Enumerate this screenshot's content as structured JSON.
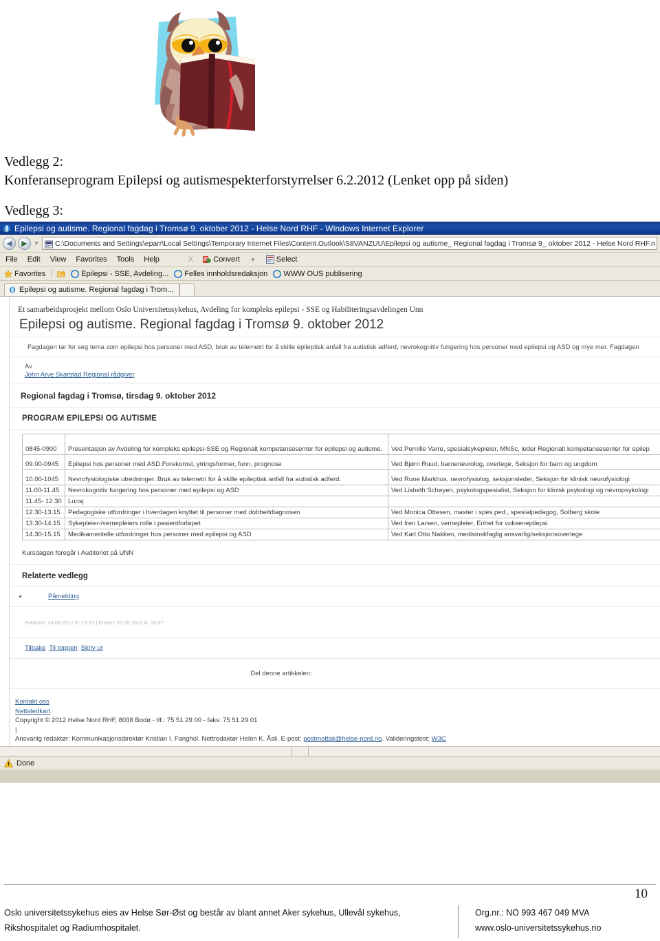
{
  "document": {
    "logo_alt": "owl-reading-book-logo",
    "headings": [
      "Vedlegg 2:",
      "Konferanseprogram Epilepsi og autismespekterforstyrrelser 6.2.2012 (Lenket opp på siden)",
      "Vedlegg 3:"
    ]
  },
  "browser": {
    "title": "Epilepsi og autisme. Regional fagdag i Tromsø 9. oktober 2012 - Helse Nord RHF - Windows Internet Explorer",
    "address": "C:\\Documents and Settings\\eparr\\Local Settings\\Temporary Internet Files\\Content.Outlook\\S8VANZUU\\Epilepsi og autisme_ Regional fagdag i Tromsø 9_ oktober 2012 - Helse Nord RHF.mht",
    "nav": {
      "back": "◀",
      "forward": "▶",
      "history_caret": "▼"
    },
    "menu": [
      "File",
      "Edit",
      "View",
      "Favorites",
      "Tools",
      "Help"
    ],
    "menu_close": "X",
    "toolbar": {
      "convert": "Convert",
      "convert_caret": "▼",
      "select": "Select"
    },
    "favorites": {
      "label": "Favorites",
      "items": [
        "Epilepsi - SSE, Avdeling...",
        "Felles innholdsredaksjon",
        "WWW OUS publisering"
      ]
    },
    "tabs": [
      "Epilepsi og autisme. Regional fagdag i Trom..."
    ],
    "status": "Done"
  },
  "page": {
    "kicker": "Et samarbeidsprosjekt mellom Oslo Universitetssykehus, Avdeling for kompleks epilepsi - SSE og Habiliteringsavdelingen Unn",
    "title": "Epilepsi og autisme. Regional fagdag i Tromsø 9. oktober 2012",
    "ingress": "Fagdagen tar for seg tema som epilepsi hos personer med ASD, bruk av telemetri for å skille epileptisk anfall fra autistisk adferd, nevrokognitiv fungering hos personer med epilepsi og ASD og mye mer. Fagdagen",
    "by_label": "Av",
    "author": "John Arve Skarstad Regional rådgiver",
    "heading2": "Regional fagdag i Tromsø, tirsdag 9. oktober 2012",
    "program_heading": "PROGRAM EPILEPSI OG AUTISME",
    "program": [
      {
        "time": "0845-0900",
        "topic": "Presentasjon av Avdeling for kompleks epilepsi-SSE og Regionalt kompetansesenter for epilepsi og autisme.",
        "speaker": "Ved Pernille Varre, spesialsykepleier, MNSc, leder Regionalt kompetansesenter for epilep"
      },
      {
        "time": "09.00-0945",
        "topic": "Epilepsi hos personer med ASD.Forekomst, ytringsformer, funn, prognose",
        "speaker": "Ved Bjørn Ruud, barnenevrolog, overlege, Seksjon for barn og ungdom"
      },
      {
        "time": "10.00-1045",
        "topic": "Nevrofysiologiske utredninger. Bruk av telemetri for å skille epileptisk anfall fra autistisk adferd.",
        "speaker": "Ved Rune Markhus, nevrofysiolog, seksjonsleder, Seksjon for klinisk nevrofysiologi"
      },
      {
        "time": "11.00-11.45",
        "topic": "Nevrokognitiv fungering hos personer med epilepsi og ASD",
        "speaker": "Ved Lisbeth Schøyen, psykologspesialist, Seksjon for klinisk psykologi og nevropsykologi"
      },
      {
        "time": "11.45- 12.30",
        "topic": "Lunsj",
        "speaker": ""
      },
      {
        "time": "12.30-13.15",
        "topic": "Pedagogiske utfordringer i hverdagen knyttet til personer med dobbeltdiagnosen",
        "speaker": "Ved Monica Ottesen, master i spes.ped., spesialpedagog, Solberg skole"
      },
      {
        "time": "13.30-14.15",
        "topic": "Sykepleier-/vernepleiers rolle i pasientforløpet",
        "speaker": "Ved Iren Larsen, vernepleier, Enhet for voksenepilepsi"
      },
      {
        "time": "14.30-15.15",
        "topic": "Medikamentelle utfordringer hos personer med epilepsi og ASD",
        "speaker": "Ved Karl Otto Nakken, medisinskfaglig ansvarlig/seksjonsoverlege"
      }
    ],
    "venue": "Kursdagen foregår i Auditoriet på UNN",
    "related_heading": "Relaterte vedlegg",
    "related_links": [
      "Påmelding"
    ],
    "meta": "Publisert: 24.08.2012 kl. 13:23 | Endret: 31.08.2012 kl. 10:07",
    "actions": [
      "Tilbake",
      "Til toppen",
      "Skriv ut"
    ],
    "share": "Del denne artikkelen:",
    "site_footer": {
      "links": [
        "Kontakt oss",
        "Nettstedkart"
      ],
      "copyright": "Copyright © 2012 Helse Nord RHF, 8038 Bodø - tlf.: 75 51 29 00 - faks: 75 51 29 01",
      "pipe": "|",
      "editor_prefix": "Ansvarlig redaktør: Kommunikasjonsdirektør Kristian I. Fanghol. Nettredaktør Helen K. Åsli. E-post:",
      "email": "postmottak@helse-nord.no",
      "validator_label": ". Valideringstest:",
      "validator": "W3C"
    }
  },
  "footer": {
    "page_number": "10",
    "left_line1": "Oslo universitetssykehus eies av Helse Sør-Øst og består av blant annet Aker sykehus, Ullevål sykehus,",
    "left_line2": "Rikshospitalet og Radiumhospitalet.",
    "right_line1": "Org.nr.: NO 993 467 049 MVA",
    "right_line2": "www.oslo-universitetssykehus.no"
  },
  "colors": {
    "titlebar": "#12419a",
    "chrome": "#ebe8dd",
    "link": "#2a5d93",
    "owl_bg": "#7fd9ee",
    "owl_body": "#a8736a",
    "owl_face": "#f7efc8",
    "book": "#6b1f22"
  }
}
